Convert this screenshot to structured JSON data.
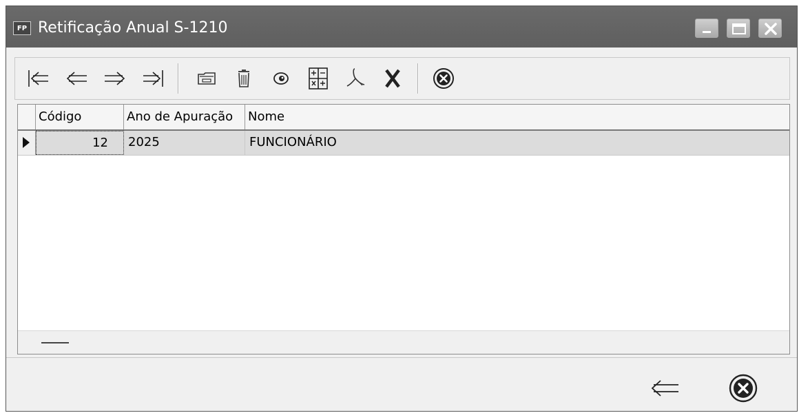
{
  "window": {
    "app_icon_text": "FP",
    "title": "Retificação Anual S-1210",
    "controls": [
      "minimize-icon",
      "maximize-icon",
      "close-icon"
    ]
  },
  "toolbar": {
    "buttons": [
      {
        "name": "first-record",
        "icon": "first-record-icon"
      },
      {
        "name": "previous-record",
        "icon": "previous-record-icon"
      },
      {
        "name": "next-record",
        "icon": "next-record-icon"
      },
      {
        "name": "last-record",
        "icon": "last-record-icon"
      },
      {
        "name": "open",
        "icon": "open-folder-icon"
      },
      {
        "name": "delete",
        "icon": "trash-icon"
      },
      {
        "name": "view",
        "icon": "eye-icon"
      },
      {
        "name": "calculate",
        "icon": "calculator-icon"
      },
      {
        "name": "export-pdf",
        "icon": "pdf-icon"
      },
      {
        "name": "export-excel",
        "icon": "excel-x-icon"
      },
      {
        "name": "close",
        "icon": "close-circle-icon"
      }
    ]
  },
  "grid": {
    "columns": [
      "Código",
      "Ano de Apuração",
      "Nome"
    ],
    "rows": [
      {
        "codigo": "12",
        "ano": "2025",
        "nome": "FUNCIONÁRIO",
        "selected": true
      }
    ]
  },
  "bottom": {
    "buttons": [
      {
        "name": "back",
        "icon": "back-arrow-icon"
      },
      {
        "name": "cancel",
        "icon": "close-circle-icon"
      }
    ]
  },
  "colors": {
    "titlebar": "#606060",
    "selected_row": "#dcdcdc",
    "surface": "#f0f0f0"
  }
}
